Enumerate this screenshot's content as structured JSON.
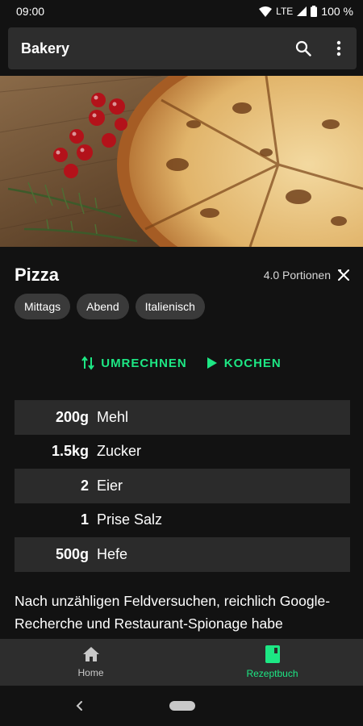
{
  "status": {
    "time": "09:00",
    "network": "LTE",
    "battery": "100 %"
  },
  "app_bar": {
    "title": "Bakery",
    "icons": [
      "search-icon",
      "more-vert-icon"
    ]
  },
  "hero": {
    "image": "pizza-photo"
  },
  "recipe": {
    "title": "Pizza",
    "portions": "4.0 Portionen",
    "tags": [
      "Mittags",
      "Abend",
      "Italienisch"
    ]
  },
  "actions": {
    "convert": "UMRECHNEN",
    "cook": "KOCHEN"
  },
  "ingredients": [
    {
      "amount": "200g",
      "name": "Mehl"
    },
    {
      "amount": "1.5kg",
      "name": "Zucker"
    },
    {
      "amount": "2",
      "name": "Eier"
    },
    {
      "amount": "1",
      "name": "Prise Salz"
    },
    {
      "amount": "500g",
      "name": "Hefe"
    }
  ],
  "description": "Nach unzähligen Feldversuchen, reichlich Google-Recherche und Restaurant-Spionage habe",
  "bottom_nav": {
    "items": [
      {
        "label": "Home",
        "icon": "home-icon",
        "active": false
      },
      {
        "label": "Rezeptbuch",
        "icon": "book-icon",
        "active": true
      }
    ]
  },
  "colors": {
    "accent": "#1de784",
    "background": "#121212",
    "surface": "#2d2d2d",
    "chip": "#3a3a3a",
    "row_shade": "#2b2b2b"
  }
}
